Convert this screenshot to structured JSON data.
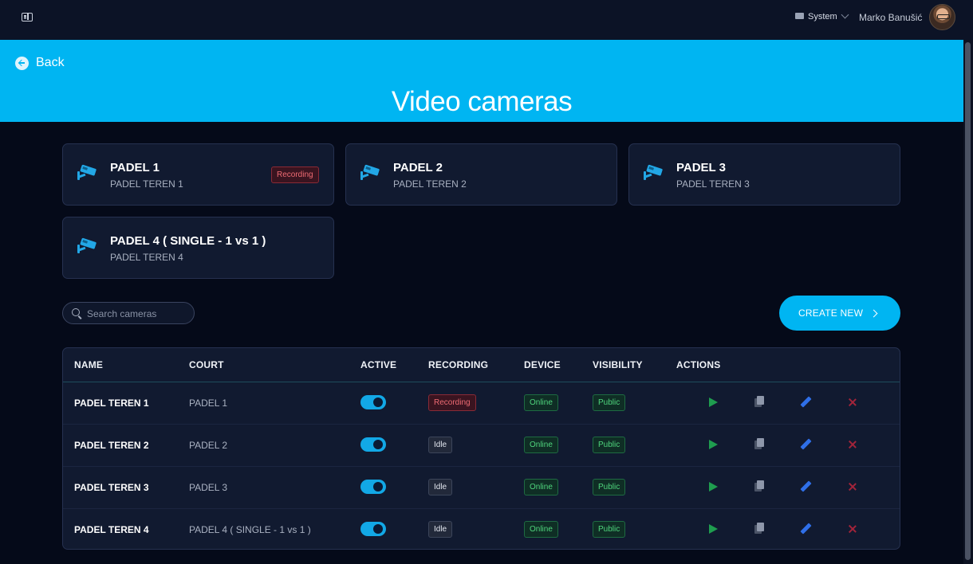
{
  "topbar": {
    "menu_icon": "sidebar-toggle-icon",
    "theme_label": "System",
    "user_name": "Marko Banušić"
  },
  "banner": {
    "back_label": "Back",
    "title": "Video cameras",
    "color": "#00b5f2"
  },
  "cards": [
    {
      "title": "PADEL 1",
      "subtitle": "PADEL TEREN 1",
      "badge": "Recording"
    },
    {
      "title": "PADEL 2",
      "subtitle": "PADEL TEREN 2",
      "badge": ""
    },
    {
      "title": "PADEL 3",
      "subtitle": "PADEL TEREN 3",
      "badge": ""
    },
    {
      "title": "PADEL 4 ( SINGLE - 1 vs 1 )",
      "subtitle": "PADEL TEREN 4",
      "badge": ""
    }
  ],
  "search": {
    "placeholder": "Search cameras",
    "value": ""
  },
  "create_button": {
    "label": "CREATE NEW"
  },
  "table": {
    "headers": [
      "NAME",
      "COURT",
      "ACTIVE",
      "RECORDING",
      "DEVICE",
      "VISIBILITY",
      "ACTIONS"
    ],
    "rows": [
      {
        "name": "PADEL TEREN 1",
        "court": "PADEL 1",
        "active": true,
        "recording": "Recording",
        "device": "Online",
        "visibility": "Public"
      },
      {
        "name": "PADEL TEREN 2",
        "court": "PADEL 2",
        "active": true,
        "recording": "Idle",
        "device": "Online",
        "visibility": "Public"
      },
      {
        "name": "PADEL TEREN 3",
        "court": "PADEL 3",
        "active": true,
        "recording": "Idle",
        "device": "Online",
        "visibility": "Public"
      },
      {
        "name": "PADEL TEREN 4",
        "court": "PADEL 4 ( SINGLE - 1 vs 1 )",
        "active": true,
        "recording": "Idle",
        "device": "Online",
        "visibility": "Public"
      }
    ],
    "action_icons": [
      "play-icon",
      "copy-icon",
      "edit-icon",
      "delete-icon"
    ]
  },
  "colors": {
    "accent": "#00b5f2",
    "background": "#050a19",
    "recording": "#ef6b73",
    "online": "#4fd57d",
    "delete": "#a3243a"
  }
}
